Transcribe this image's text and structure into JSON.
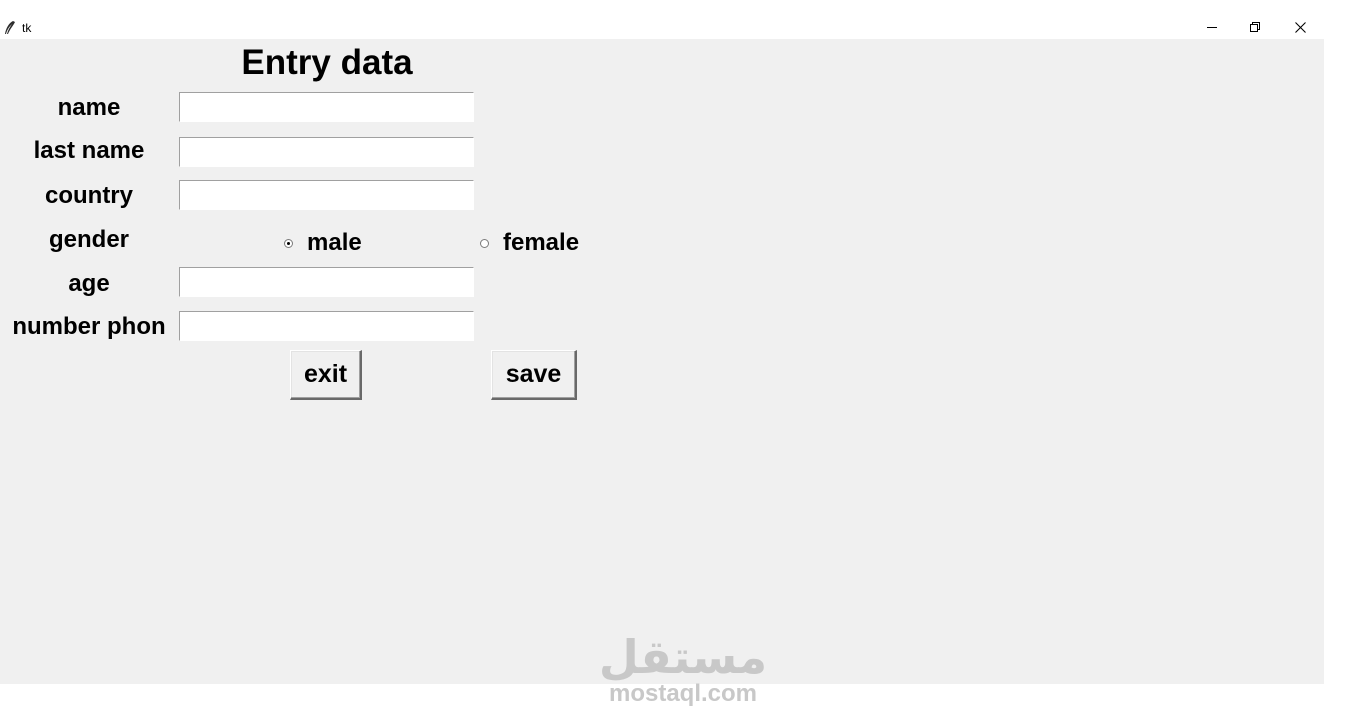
{
  "window": {
    "title": "tk",
    "controls": {
      "minimize": "minimize-icon",
      "restore": "restore-icon",
      "close": "close-icon"
    }
  },
  "form": {
    "heading": "Entry data",
    "fields": {
      "name": {
        "label": "name",
        "value": ""
      },
      "last_name": {
        "label": "last name",
        "value": ""
      },
      "country": {
        "label": "country",
        "value": ""
      },
      "age": {
        "label": "age",
        "value": ""
      },
      "phone": {
        "label": "number phon",
        "value": ""
      }
    },
    "gender": {
      "label": "gender",
      "options": [
        {
          "label": "male",
          "selected": true
        },
        {
          "label": "female",
          "selected": false
        }
      ]
    },
    "buttons": {
      "exit": "exit",
      "save": "save"
    }
  },
  "watermark": {
    "arabic": "مستقل",
    "latin": "mostaql.com"
  },
  "colors": {
    "window_background": "#f0f0f0",
    "titlebar_background": "#ffffff",
    "watermark": "#c8c8c8"
  }
}
